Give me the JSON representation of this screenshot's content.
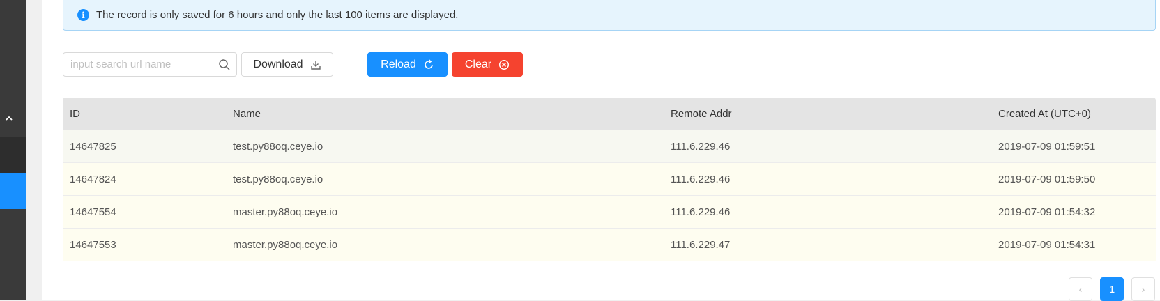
{
  "alert": {
    "icon": "info-icon",
    "icon_glyph": "i",
    "message": "The record is only saved for 6 hours and only the last 100 items are displayed."
  },
  "toolbar": {
    "search_placeholder": "input search url name",
    "search_value": "",
    "download_label": "Download",
    "reload_label": "Reload",
    "clear_label": "Clear"
  },
  "table": {
    "columns": [
      "ID",
      "Name",
      "Remote Addr",
      "Created At (UTC+0)"
    ],
    "rows": [
      {
        "id": "14647825",
        "name": "test.py88oq.ceye.io",
        "remote_addr": "111.6.229.46",
        "created_at": "2019-07-09 01:59:51"
      },
      {
        "id": "14647824",
        "name": "test.py88oq.ceye.io",
        "remote_addr": "111.6.229.46",
        "created_at": "2019-07-09 01:59:50"
      },
      {
        "id": "14647554",
        "name": "master.py88oq.ceye.io",
        "remote_addr": "111.6.229.46",
        "created_at": "2019-07-09 01:54:32"
      },
      {
        "id": "14647553",
        "name": "master.py88oq.ceye.io",
        "remote_addr": "111.6.229.47",
        "created_at": "2019-07-09 01:54:31"
      }
    ]
  },
  "pagination": {
    "prev": "‹",
    "current": "1",
    "next": "›"
  },
  "colors": {
    "primary": "#1890ff",
    "danger": "#f5432f",
    "sidebar": "#3a3a3a",
    "alert_bg": "#e6f4fd"
  }
}
